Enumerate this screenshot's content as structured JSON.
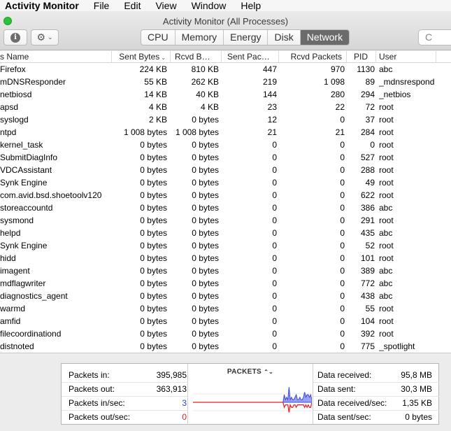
{
  "menubar": {
    "app": "Activity Monitor",
    "items": [
      "File",
      "Edit",
      "View",
      "Window",
      "Help"
    ]
  },
  "window": {
    "title": "Activity Monitor (All Processes)"
  },
  "toolbar": {
    "info_glyph": "i",
    "gear_glyph": "⚙",
    "gear_chevron": "⌄",
    "tabs": [
      "CPU",
      "Memory",
      "Energy",
      "Disk",
      "Network"
    ],
    "active_tab": "Network",
    "search_glyph": "C"
  },
  "table": {
    "columns": [
      "s Name",
      "Sent Bytes",
      "Rcvd B…",
      "Sent Pac…",
      "Rcvd Packets",
      "PID",
      "User"
    ],
    "sort_indicator": "⌄",
    "rows": [
      [
        "Firefox",
        "224 KB",
        "810 KB",
        "447",
        "970",
        "1130",
        "abc"
      ],
      [
        "mDNSResponder",
        "55 KB",
        "262 KB",
        "219",
        "1 098",
        "89",
        "_mdnsrespond"
      ],
      [
        "netbiosd",
        "14 KB",
        "40 KB",
        "144",
        "280",
        "294",
        "_netbios"
      ],
      [
        "apsd",
        "4 KB",
        "4 KB",
        "23",
        "22",
        "72",
        "root"
      ],
      [
        "syslogd",
        "2 KB",
        "0 bytes",
        "12",
        "0",
        "37",
        "root"
      ],
      [
        "ntpd",
        "1 008 bytes",
        "1 008 bytes",
        "21",
        "21",
        "284",
        "root"
      ],
      [
        "kernel_task",
        "0 bytes",
        "0 bytes",
        "0",
        "0",
        "0",
        "root"
      ],
      [
        "SubmitDiagInfo",
        "0 bytes",
        "0 bytes",
        "0",
        "0",
        "527",
        "root"
      ],
      [
        "VDCAssistant",
        "0 bytes",
        "0 bytes",
        "0",
        "0",
        "288",
        "root"
      ],
      [
        "Synk Engine",
        "0 bytes",
        "0 bytes",
        "0",
        "0",
        "49",
        "root"
      ],
      [
        "com.avid.bsd.shoetoolv120",
        "0 bytes",
        "0 bytes",
        "0",
        "0",
        "622",
        "root"
      ],
      [
        "storeaccountd",
        "0 bytes",
        "0 bytes",
        "0",
        "0",
        "386",
        "abc"
      ],
      [
        "sysmond",
        "0 bytes",
        "0 bytes",
        "0",
        "0",
        "291",
        "root"
      ],
      [
        "helpd",
        "0 bytes",
        "0 bytes",
        "0",
        "0",
        "435",
        "abc"
      ],
      [
        "Synk Engine",
        "0 bytes",
        "0 bytes",
        "0",
        "0",
        "52",
        "root"
      ],
      [
        "hidd",
        "0 bytes",
        "0 bytes",
        "0",
        "0",
        "101",
        "root"
      ],
      [
        "imagent",
        "0 bytes",
        "0 bytes",
        "0",
        "0",
        "389",
        "abc"
      ],
      [
        "mdflagwriter",
        "0 bytes",
        "0 bytes",
        "0",
        "0",
        "772",
        "abc"
      ],
      [
        "diagnostics_agent",
        "0 bytes",
        "0 bytes",
        "0",
        "0",
        "438",
        "abc"
      ],
      [
        "warmd",
        "0 bytes",
        "0 bytes",
        "0",
        "0",
        "55",
        "root"
      ],
      [
        "amfid",
        "0 bytes",
        "0 bytes",
        "0",
        "0",
        "104",
        "root"
      ],
      [
        "filecoordinationd",
        "0 bytes",
        "0 bytes",
        "0",
        "0",
        "392",
        "root"
      ],
      [
        "distnoted",
        "0 bytes",
        "0 bytes",
        "0",
        "0",
        "775",
        "_spotlight"
      ]
    ]
  },
  "stats": {
    "left": [
      {
        "label": "Packets in:",
        "value": "395,985",
        "color": "#000000"
      },
      {
        "label": "Packets out:",
        "value": "363,913",
        "color": "#000000"
      },
      {
        "label": "Packets in/sec:",
        "value": "3",
        "color": "#2a3fd6"
      },
      {
        "label": "Packets out/sec:",
        "value": "0",
        "color": "#e0201b"
      }
    ],
    "right": [
      {
        "label": "Data received:",
        "value": "95,8 MB"
      },
      {
        "label": "Data sent:",
        "value": "30,3 MB"
      },
      {
        "label": "Data received/sec:",
        "value": "1,35 KB"
      },
      {
        "label": "Data sent/sec:",
        "value": "0 bytes"
      }
    ],
    "chart_title": "PACKETS",
    "chart_toggle_glyph": "⌃⌄"
  },
  "colors": {
    "in_series": "#3a48e0",
    "in_fill": "#9aa0f2",
    "out_series": "#e0201b"
  },
  "chart_data": {
    "type": "area",
    "series": [
      {
        "values": [
          0,
          0,
          0,
          0,
          0,
          0,
          0,
          0,
          0,
          0,
          0,
          0,
          0,
          0,
          0,
          0,
          0,
          0,
          0,
          0,
          0,
          0,
          0,
          0,
          0,
          0,
          0,
          0,
          0,
          0,
          0,
          0,
          0,
          0,
          0,
          0,
          0,
          0,
          0,
          0,
          0,
          0,
          0,
          0,
          0,
          0,
          0,
          0,
          0,
          0,
          0,
          0,
          0,
          0,
          0,
          0,
          0,
          0,
          0,
          0,
          0,
          0,
          0,
          0,
          0,
          0,
          0,
          0,
          0,
          0,
          0,
          0,
          0,
          0,
          0,
          0,
          3,
          1,
          2,
          1,
          6,
          1,
          2,
          1,
          1,
          2,
          3,
          1,
          1,
          2,
          1,
          1,
          2,
          4,
          2,
          3,
          3,
          2,
          3,
          1
        ]
      },
      {
        "values": [
          0,
          0,
          0,
          0,
          0,
          0,
          0,
          0,
          0,
          0,
          0,
          0,
          0,
          0,
          0,
          0,
          0,
          0,
          0,
          0,
          0,
          0,
          0,
          0,
          0,
          0,
          0,
          0,
          0,
          0,
          0,
          0,
          0,
          0,
          0,
          0,
          0,
          0,
          0,
          0,
          0,
          0,
          0,
          0,
          0,
          0,
          0,
          0,
          0,
          0,
          0,
          0,
          0,
          0,
          0,
          0,
          0,
          0,
          0,
          0,
          0,
          0,
          0,
          0,
          0,
          0,
          0,
          0,
          0,
          0,
          0,
          0,
          0,
          0,
          0,
          0,
          2,
          1,
          1,
          1,
          4,
          1,
          2,
          2,
          1,
          1,
          2,
          1,
          1,
          1,
          1,
          1,
          1,
          2,
          1,
          2,
          1,
          2,
          2,
          0
        ]
      }
    ],
    "ylim": [
      -8,
      8
    ]
  }
}
